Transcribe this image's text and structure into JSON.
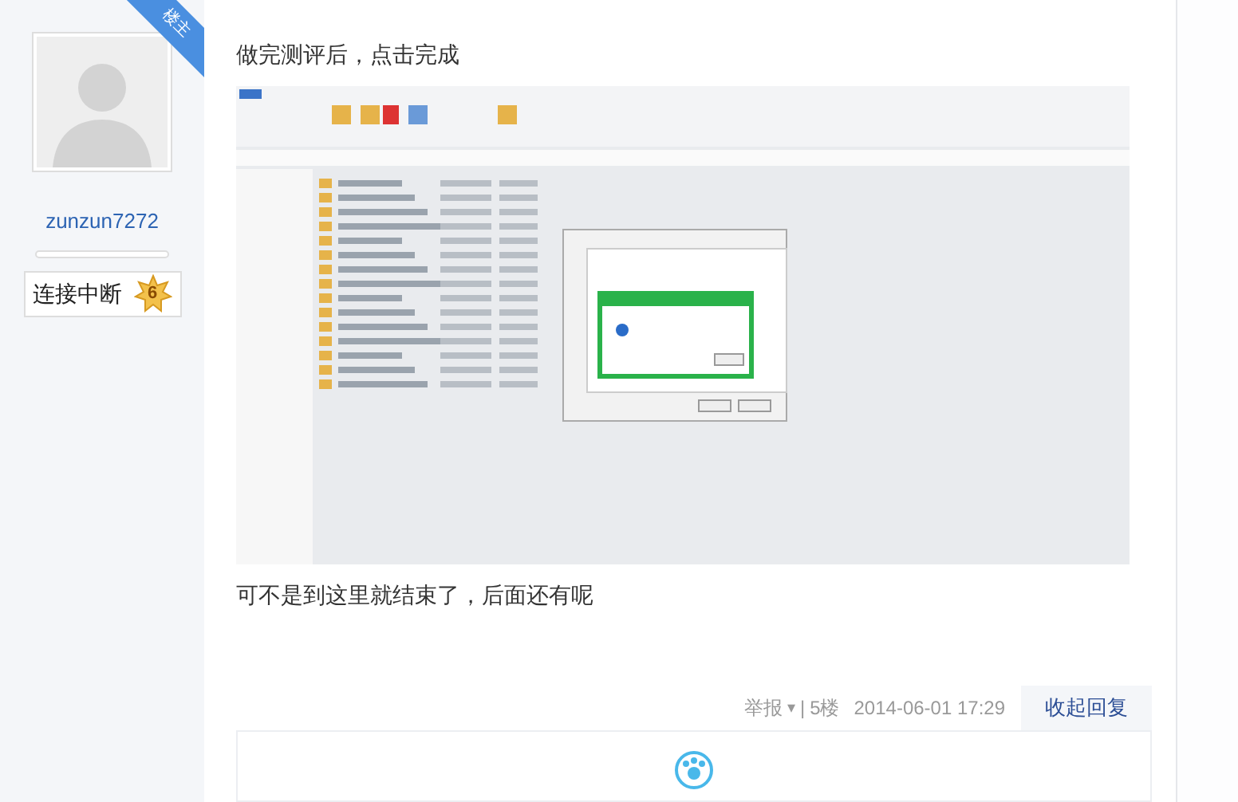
{
  "author": {
    "corner_tag": "楼主",
    "username": "zunzun7272",
    "badge": {
      "title": "连接中断",
      "level": "6"
    }
  },
  "post": {
    "paragraphs": [
      "做完测评后，点击完成",
      "可不是到这里就结束了，后面还有呢"
    ]
  },
  "footer": {
    "report": "举报",
    "report_caret": "▾",
    "separator": "|",
    "floor": "5楼",
    "time": "2014-06-01 17:29",
    "toggle_replies": "收起回复"
  }
}
